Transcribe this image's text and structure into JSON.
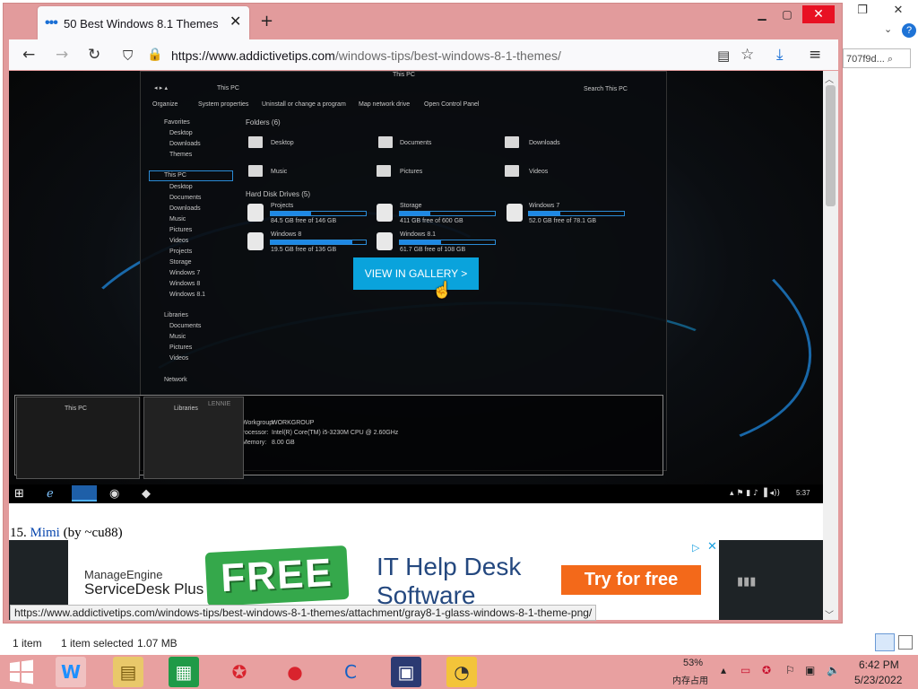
{
  "browser": {
    "tab_title": "50 Best Windows 8.1 Themes",
    "url_domain": "https://www.addictivetips.com",
    "url_path": "/windows-tips/best-windows-8-1-themes/",
    "link_preview": "https://www.addictivetips.com/windows-tips/best-windows-8-1-themes/attachment/gray8-1-glass-windows-8-1-theme-png/"
  },
  "background_window": {
    "search_text": "707f9d...",
    "status_items": "1 item",
    "status_selected": "1 item selected",
    "status_size": "1.07 MB"
  },
  "page": {
    "gallery_button": "VIEW IN GALLERY >",
    "heading_number": "15.",
    "heading_link": "Mimi",
    "heading_rest": "(by ~cu88)"
  },
  "screenshot": {
    "window_title": "This PC",
    "search": "Search This PC",
    "toolbar": [
      "Organize",
      "System properties",
      "Uninstall or change a program",
      "Map network drive",
      "Open Control Panel"
    ],
    "favorites_header": "Favorites",
    "favorites": [
      "Desktop",
      "Downloads",
      "Themes"
    ],
    "thispc_header": "This PC",
    "thispc_items": [
      "Desktop",
      "Documents",
      "Downloads",
      "Music",
      "Pictures",
      "Videos",
      "Projects",
      "Storage",
      "Windows 7",
      "Windows 8",
      "Windows 8.1"
    ],
    "libraries_header": "Libraries",
    "libraries": [
      "Documents",
      "Music",
      "Pictures",
      "Videos"
    ],
    "network": "Network",
    "folders_header": "Folders (6)",
    "folders": [
      "Desktop",
      "Documents",
      "Downloads",
      "Music",
      "Pictures",
      "Videos"
    ],
    "drives_header": "Hard Disk Drives (5)",
    "drives": [
      {
        "name": "Projects",
        "free": "84.5 GB free of 146 GB",
        "used": 0.42
      },
      {
        "name": "Storage",
        "free": "411 GB free of 600 GB",
        "used": 0.32
      },
      {
        "name": "Windows 7",
        "free": "52.0 GB free of 78.1 GB",
        "used": 0.33
      },
      {
        "name": "Windows 8",
        "free": "19.5 GB free of 136 GB",
        "used": 0.86
      },
      {
        "name": "Windows 8.1",
        "free": "61.7 GB free of 108 GB",
        "used": 0.43
      }
    ],
    "details_workgroup_label": "Workgroup:",
    "details_workgroup": "WORKGROUP",
    "details_processor_label": "Processor:",
    "details_processor": "Intel(R) Core(TM) i5-3230M CPU @ 2.60GHz",
    "details_memory_label": "Memory:",
    "details_memory": "8.00 GB",
    "thumb1_title": "This PC",
    "thumb2_title": "Libraries",
    "thumb3_title": "LENNIE",
    "clock": "5:37"
  },
  "ad": {
    "brand_line1": "ManageEngine",
    "brand_line2": "ServiceDesk Plus",
    "free": "FREE",
    "headline1": "IT Help Desk",
    "headline2": "Software",
    "cta": "Try for free"
  },
  "taskbar": {
    "mem_percent": "53%",
    "mem_label": "内存占用",
    "time": "6:42 PM",
    "date": "5/23/2022"
  },
  "colors": {
    "browser_frame": "#e29b9c",
    "close_button": "#e81123",
    "gallery_button": "#0aa3dc",
    "cta": "#f3691a",
    "link": "#0645ad"
  }
}
